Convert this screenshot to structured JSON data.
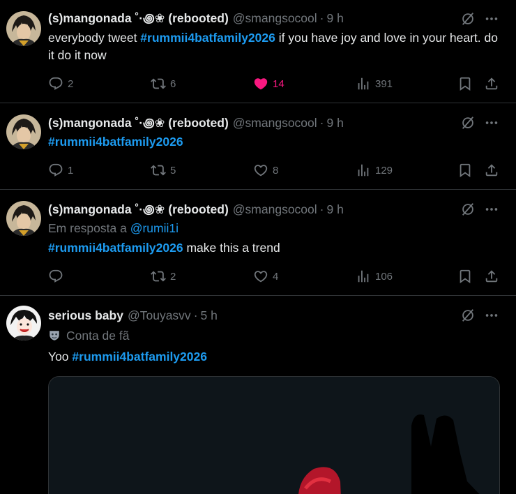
{
  "tweets": [
    {
      "name": "(s)mangonada ˚·꩜❀ (rebooted)",
      "handle": "@smangsocool",
      "separator": "·",
      "time": "9 h",
      "text_pre": "everybody tweet ",
      "hashtag": "#rummii4batfamily2026",
      "text_post": " if you have joy and love in your heart. do it do it now",
      "replies": "2",
      "retweets": "6",
      "likes": "14",
      "views": "391",
      "liked": true
    },
    {
      "name": "(s)mangonada ˚·꩜❀ (rebooted)",
      "handle": "@smangsocool",
      "separator": "·",
      "time": "9 h",
      "hashtag": "#rummii4batfamily2026",
      "replies": "1",
      "retweets": "5",
      "likes": "8",
      "views": "129"
    },
    {
      "name": "(s)mangonada ˚·꩜❀ (rebooted)",
      "handle": "@smangsocool",
      "separator": "·",
      "time": "9 h",
      "reply_prefix": "Em resposta a ",
      "reply_to": "@rumii1i",
      "hashtag": "#rummii4batfamily2026",
      "text_post": " make this a trend",
      "replies": "",
      "retweets": "2",
      "likes": "4",
      "views": "106"
    },
    {
      "name": "serious baby",
      "handle": "@Touyasvv",
      "separator": "·",
      "time": "5 h",
      "badge_label": "Conta de fã",
      "text_pre": "Yoo ",
      "hashtag": "#rummii4batfamily2026"
    }
  ],
  "icons": {
    "reply": "reply-icon",
    "retweet": "retweet-icon",
    "like": "heart-icon",
    "views": "views-icon",
    "bookmark": "bookmark-icon",
    "share": "share-icon",
    "grok": "grok-icon",
    "more": "more-icon"
  },
  "colors": {
    "background": "#000000",
    "text": "#e7e9ea",
    "muted": "#71767b",
    "link": "#1d9bf0",
    "like_active": "#f91880",
    "divider": "#2f3336"
  }
}
